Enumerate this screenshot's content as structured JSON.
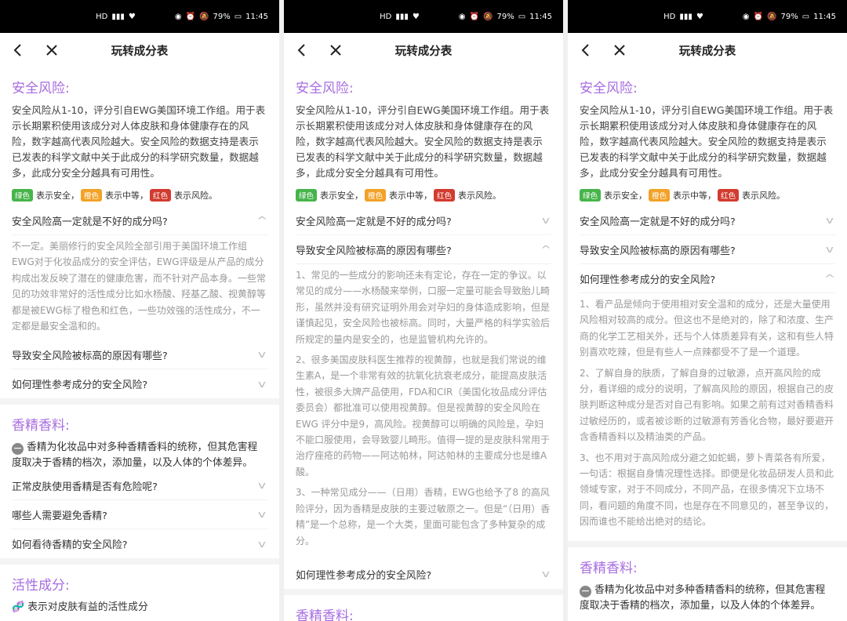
{
  "status": {
    "time": "11:45",
    "battery": "79%",
    "net": "HD",
    "signal": "4G"
  },
  "nav": {
    "title": "玩转成分表"
  },
  "safety": {
    "title": "安全风险:",
    "desc": "安全风险从1-10，评分引自EWG美国环境工作组。用于表示长期累积使用该成分对人体皮肤和身体健康存在的风险，数字越高代表风险越大。安全风险的数据支持是表示已发表的科学文献中关于此成分的科学研究数量，数据越多，此成分安全分越具有可用性。",
    "legend": {
      "green_tag": "绿色",
      "green_text": "表示安全，",
      "orange_tag": "橙色",
      "orange_text": "表示中等，",
      "red_tag": "红色",
      "red_text": "表示风险。"
    },
    "questions": [
      "安全风险高一定就是不好的成分吗?",
      "导致安全风险被标高的原因有哪些?",
      "如何理性参考成分的安全风险?"
    ],
    "answer1": "不一定。美丽修行的安全风险全部引用于美国环境工作组EWG对于化妆品成分的安全评估，EWG评级是从产品的成分构成出发反映了潜在的健康危害，而不针对产品本身。一些常见的功效非常好的活性成分比如水杨酸、羟基乙酸、视黄醇等都是被EWG标了橙色和红色，一些功效强的活性成分，不一定都是最安全温和的。",
    "answer2": [
      "1、常见的一些成分的影响还未有定论，存在一定的争议。以常见的成分——水杨酸来举例，口服一定量可能会导致胎儿畸形，虽然并没有研究证明外用会对孕妇的身体造成影响，但是谨慎起见，安全风险也被标高。同时，大量严格的科学实验后所规定的量内是安全的，也是监管机构允许的。",
      "2、很多美国皮肤科医生推荐的视黄醇，也就是我们常说的维生素A，是一个非常有效的抗氧化抗衰老成分，能提高皮肤活性，被很多大牌产品使用，FDA和CIR（美国化妆品成分评估委员会）都批准可以使用视黄醇。但是视黄醇的安全风险在EWG 评分中是9，高风险。视黄醇可以明确的风险是，孕妇不能口服使用，会导致婴儿畸形。值得一提的是皮肤科常用于治疗痤疮的药物——阿达帕林，阿达帕林的主要成分也是维A酸。",
      "3、一种常见成分——（日用）香精，EWG也给予了8 的高风险评分，因为香精是皮肤的主要过敏原之一。但是“（日用）香精”是一个总称，是一个大类，里面可能包含了多种复杂的成分。"
    ],
    "answer3": [
      "1、看产品是倾向于使用相对安全温和的成分，还是大量使用风险相对较高的成分。但这也不是绝对的，除了和浓度、生产商的化学工艺相关外，还与个人体质差异有关，这和有些人特别喜欢吃辣，但是有些人一点辣都受不了是一个道理。",
      "2、了解自身的肤质，了解自身的过敏源，点开高风险的成分，看详细的成分的说明，了解高风险的原因，根据自己的皮肤判断这种成分是否对自己有影响。如果之前有过对香精香料过敏经历的，或者被诊断的过敏源有芳香化合物，最好要避开含香精香料以及精油类的产品。",
      "3、也不用对于高风险成分避之如蛇蝎，萝卜青菜各有所爱，一句话：根据自身情况理性选择。即便是化妆品研发人员和此领域专家，对于不同成分，不同产品，在很多情况下立场不同，看问题的角度不同，也是存在不同意见的，甚至争议的，因而谁也不能给出绝对的结论。"
    ]
  },
  "fragrance": {
    "title": "香精香料:",
    "desc": "香精为化妆品中对多种香精香料的统称，但其危害程度取决于香精的档次，添加量，以及人体的个体差异。",
    "questions": [
      "正常皮肤使用香精是否有危险呢?",
      "哪些人需要避免香精?",
      "如何看待香精的安全风险?"
    ]
  },
  "active": {
    "title": "活性成分:",
    "desc": "表示对皮肤有益的活性成分"
  }
}
